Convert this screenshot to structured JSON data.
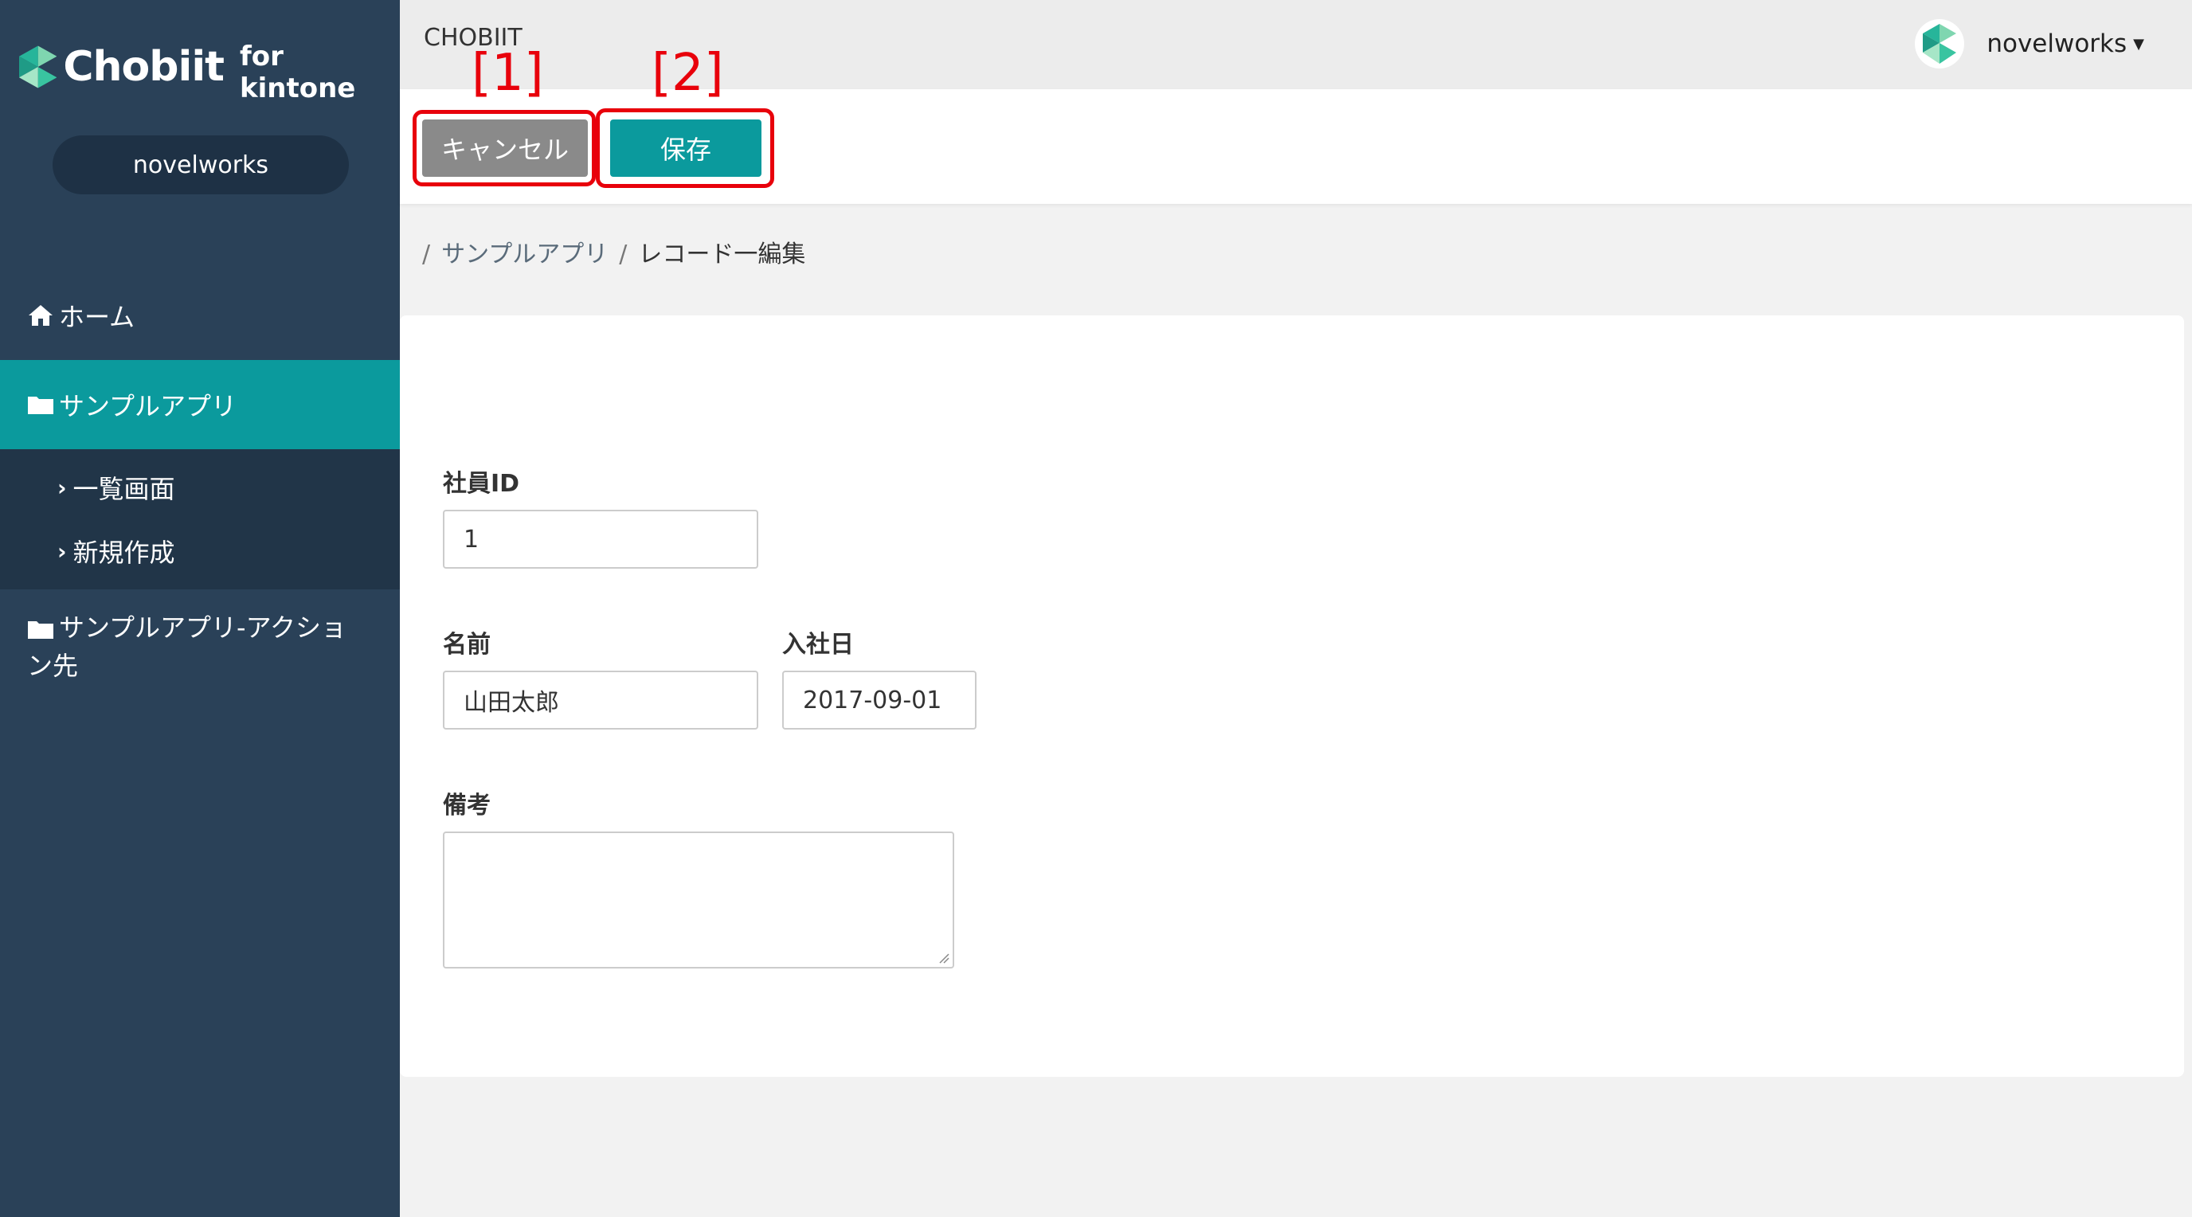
{
  "sidebar": {
    "brand_name": "Chobiit",
    "brand_sub": "for kintone",
    "user": "novelworks",
    "home_label": "ホーム",
    "app_label": "サンプルアプリ",
    "sub_items": [
      {
        "label": "一覧画面"
      },
      {
        "label": "新規作成"
      }
    ],
    "app2_label": "サンプルアプリ-アクション先"
  },
  "header": {
    "app_title": "CHOBIIT",
    "account_name": "novelworks"
  },
  "toolbar": {
    "cancel_label": "キャンセル",
    "save_label": "保存"
  },
  "annotations": {
    "label1": "[1]",
    "label2": "[2]",
    "highlight_color": "#e8000b"
  },
  "breadcrumb": {
    "separator": "/",
    "app": "サンプルアプリ",
    "current": "レコード一編集"
  },
  "form": {
    "employee_id_label": "社員ID",
    "employee_id_value": "1",
    "name_label": "名前",
    "name_value": "山田太郎",
    "join_date_label": "入社日",
    "join_date_value": "2017-09-01",
    "notes_label": "備考",
    "notes_value": ""
  },
  "colors": {
    "sidebar_bg": "#2a4158",
    "accent": "#0b9a9d",
    "cancel_bg": "#8a8a8a"
  },
  "icons": {
    "home": "home-icon",
    "folder": "folder-icon",
    "chevron": "chevron-right-icon",
    "caret": "caret-down-icon"
  }
}
